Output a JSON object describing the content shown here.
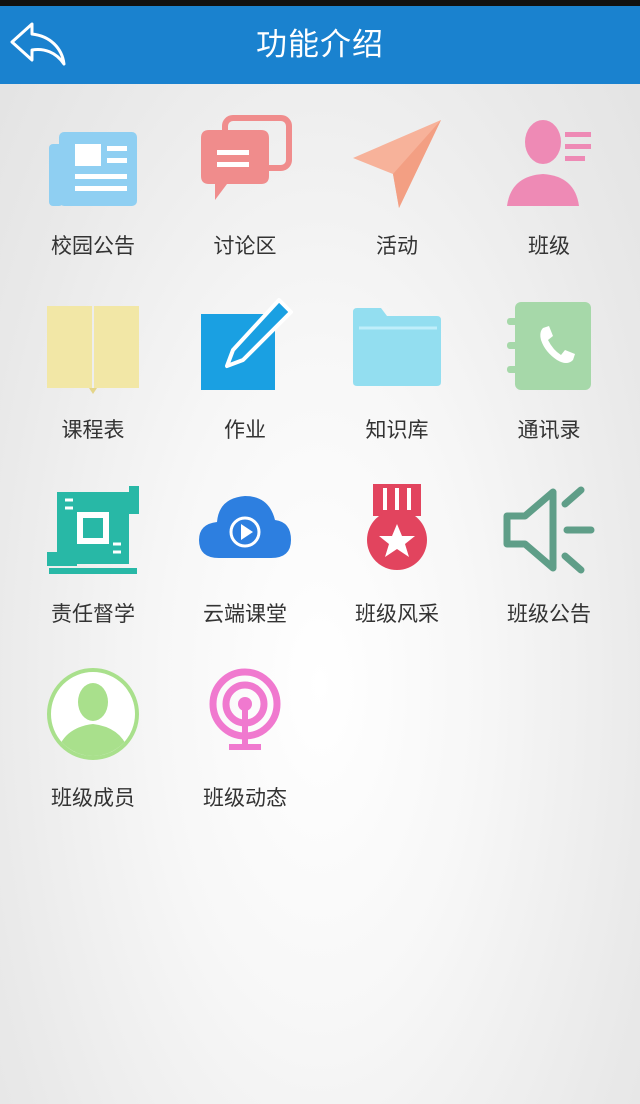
{
  "header": {
    "title": "功能介绍"
  },
  "features": [
    {
      "label": "校园公告",
      "icon": "newspaper-icon",
      "color": "#8fcff2"
    },
    {
      "label": "讨论区",
      "icon": "chat-bubbles-icon",
      "color": "#f08c8c"
    },
    {
      "label": "活动",
      "icon": "paper-plane-icon",
      "color": "#f7b29a"
    },
    {
      "label": "班级",
      "icon": "contact-card-icon",
      "color": "#ee8ab5"
    },
    {
      "label": "课程表",
      "icon": "book-icon",
      "color": "#f2e7a6"
    },
    {
      "label": "作业",
      "icon": "edit-icon",
      "color": "#1aa0e2"
    },
    {
      "label": "知识库",
      "icon": "folder-icon",
      "color": "#93def0"
    },
    {
      "label": "通讯录",
      "icon": "address-book-icon",
      "color": "#a6d8a9"
    },
    {
      "label": "责任督学",
      "icon": "circuit-board-icon",
      "color": "#28b8a6"
    },
    {
      "label": "云端课堂",
      "icon": "cloud-play-icon",
      "color": "#2d7fe0"
    },
    {
      "label": "班级风采",
      "icon": "medal-icon",
      "color": "#e2445e"
    },
    {
      "label": "班级公告",
      "icon": "speaker-icon",
      "color": "#5f9e88"
    },
    {
      "label": "班级成员",
      "icon": "member-avatar-icon",
      "color": "#a9e08c"
    },
    {
      "label": "班级动态",
      "icon": "broadcast-icon",
      "color": "#f079cf"
    }
  ]
}
